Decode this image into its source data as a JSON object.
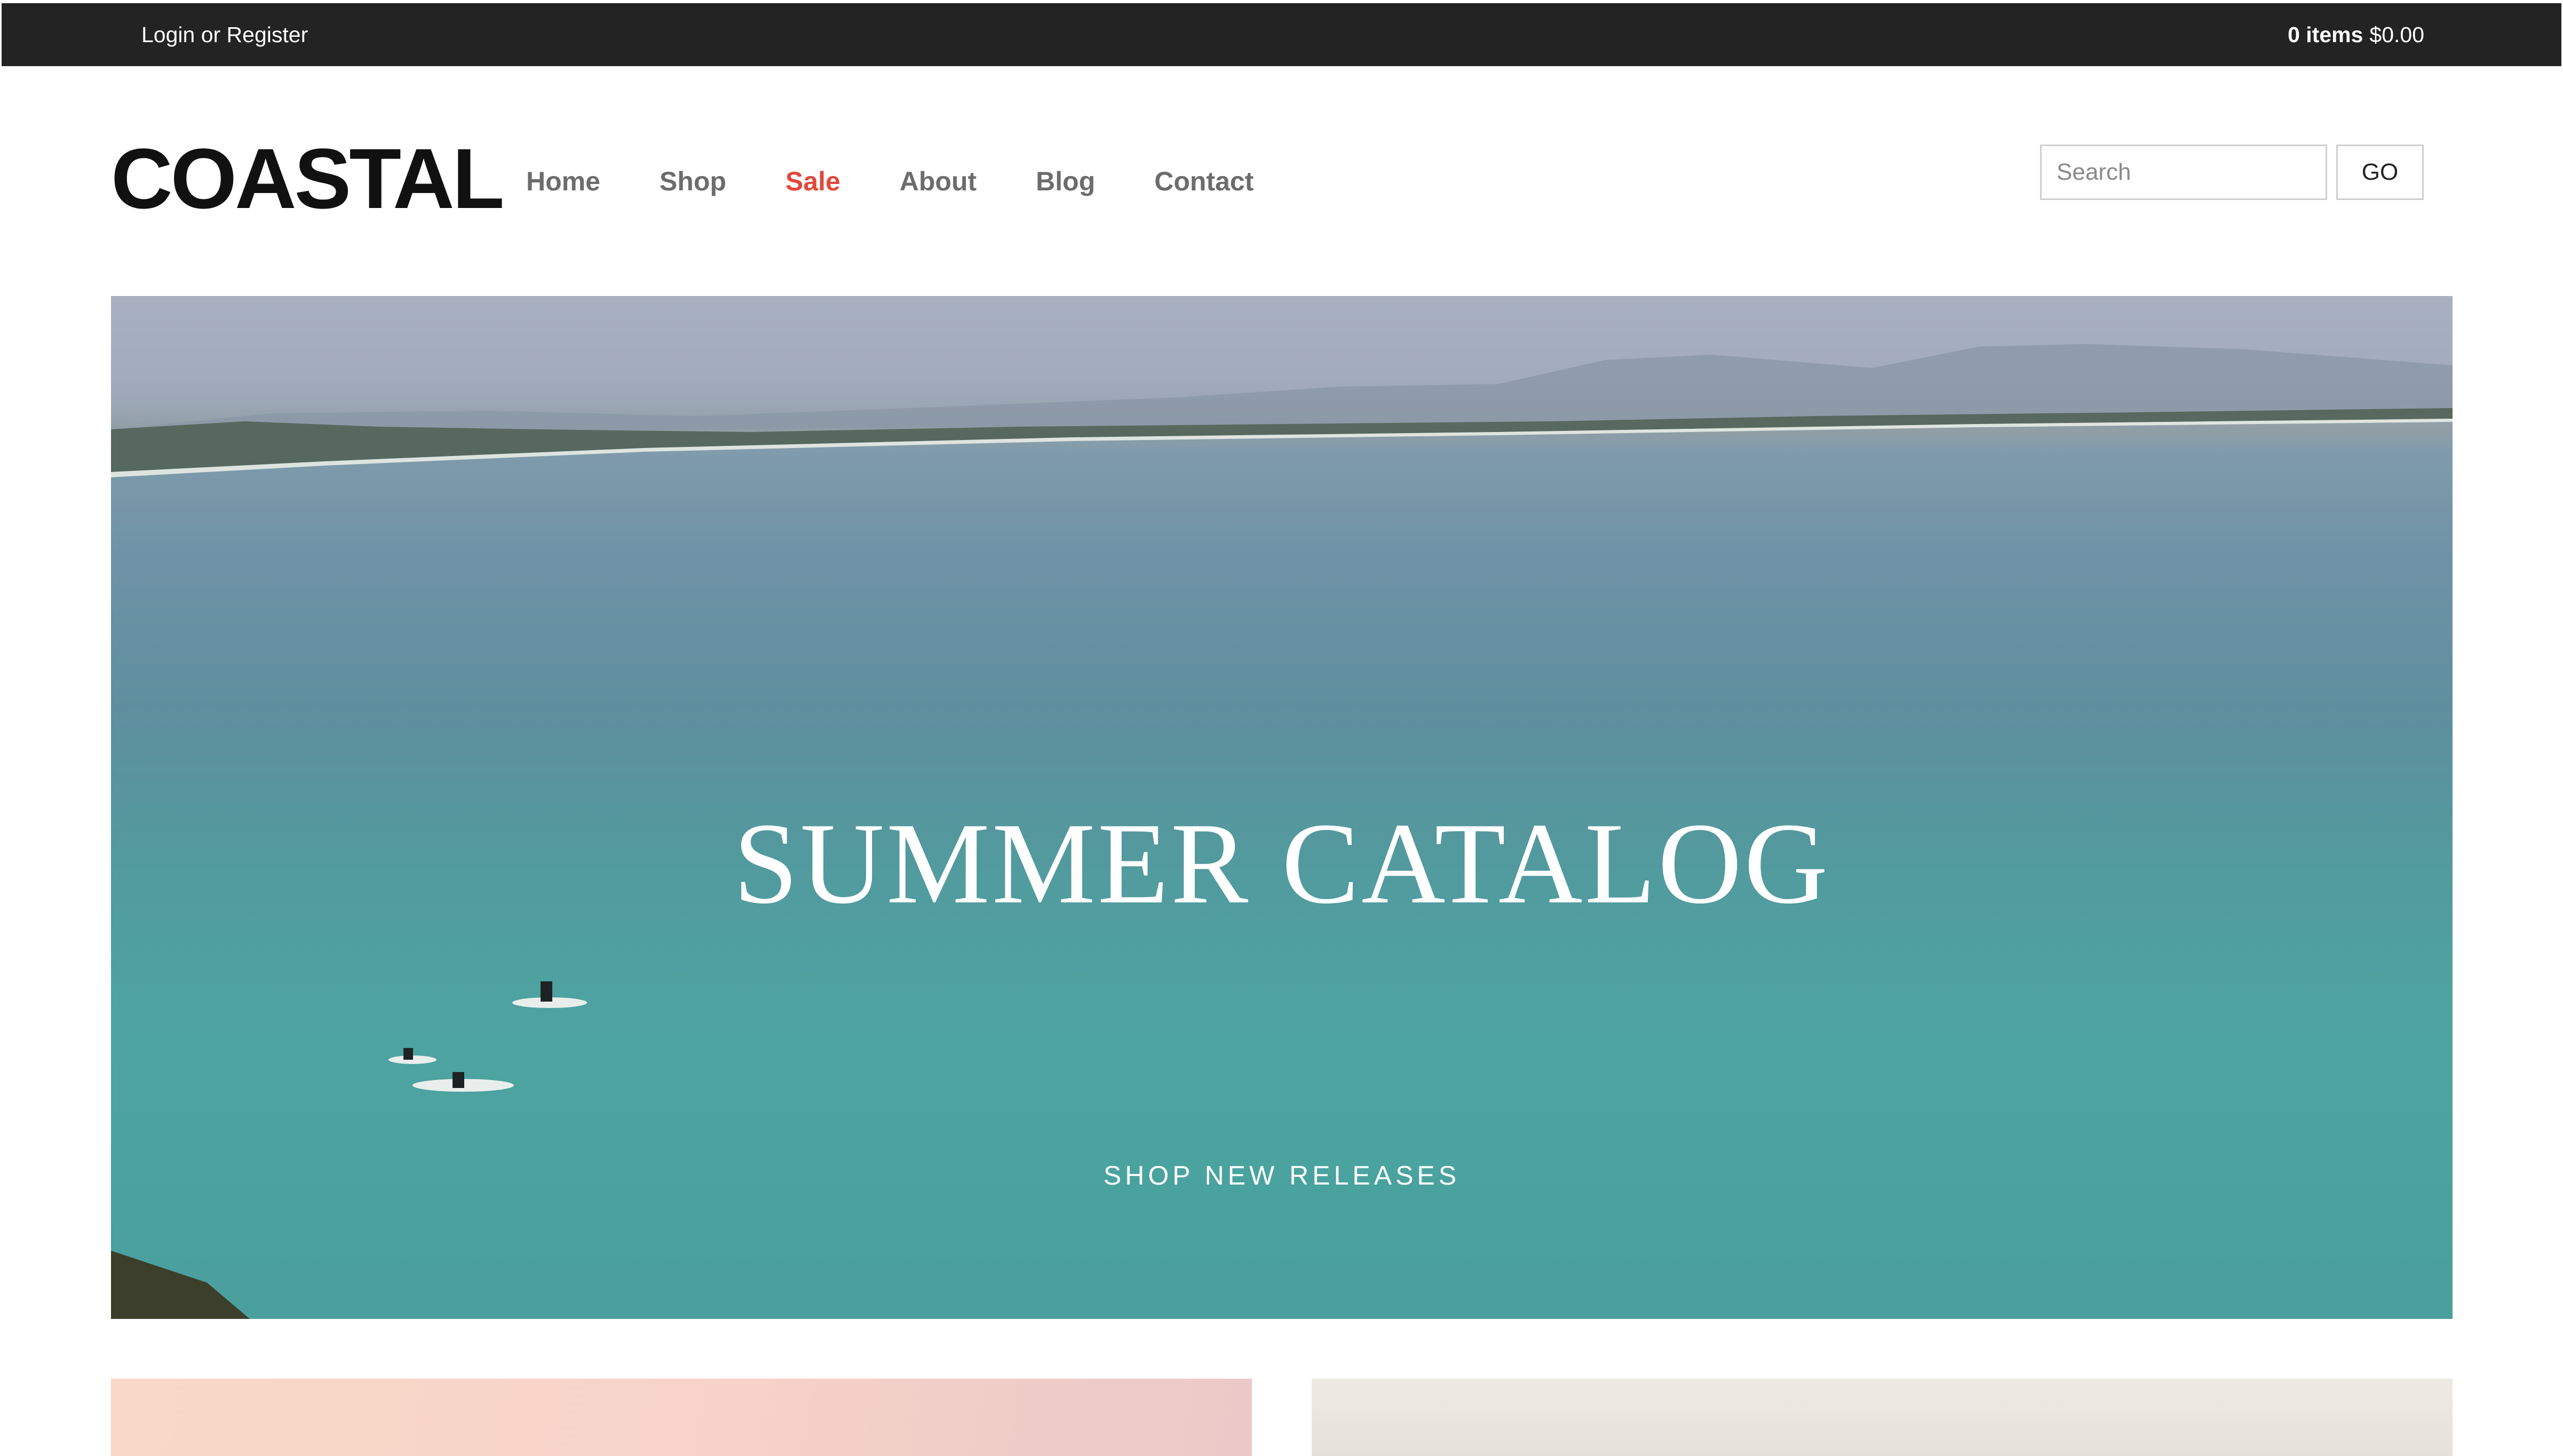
{
  "topbar": {
    "login_label": "Login or Register",
    "cart_count": "0 items",
    "cart_total": "$0.00"
  },
  "header": {
    "logo": "COASTAL",
    "nav": [
      {
        "label": "Home"
      },
      {
        "label": "Shop"
      },
      {
        "label": "Sale"
      },
      {
        "label": "About"
      },
      {
        "label": "Blog"
      },
      {
        "label": "Contact"
      }
    ],
    "search": {
      "placeholder": "Search",
      "value": "",
      "button_label": "GO"
    }
  },
  "hero": {
    "title": "SUMMER CATALOG",
    "subtitle": "SHOP NEW RELEASES"
  },
  "colors": {
    "topbar_bg": "#232323",
    "accent_sale": "#e2483b",
    "nav_text": "#6c6c6c",
    "logo_text": "#111111"
  }
}
